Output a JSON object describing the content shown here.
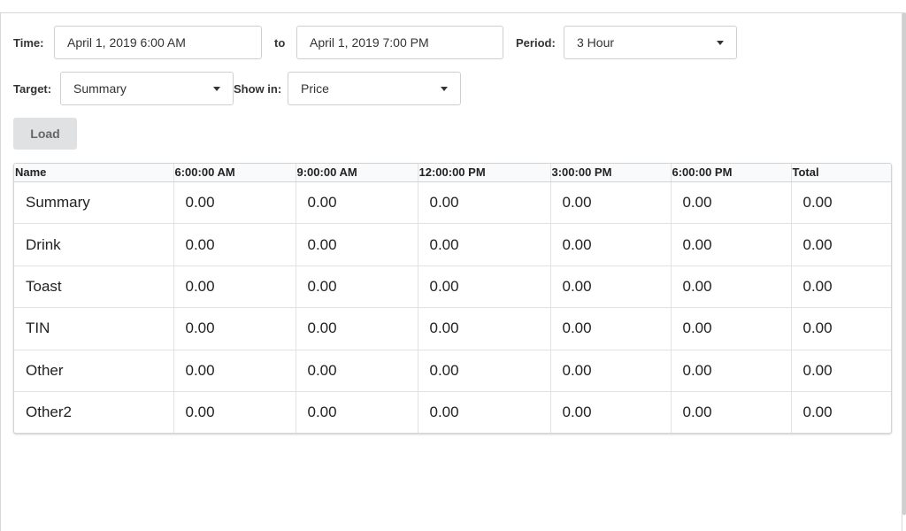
{
  "filters": {
    "time_label": "Time:",
    "time_from": "April 1, 2019 6:00 AM",
    "to_label": "to",
    "time_to": "April 1, 2019 7:00 PM",
    "period_label": "Period:",
    "period_value": "3 Hour",
    "target_label": "Target:",
    "target_value": "Summary",
    "show_in_label": "Show in:",
    "show_in_value": "Price",
    "load_label": "Load"
  },
  "table": {
    "headers": [
      "Name",
      "6:00:00 AM",
      "9:00:00 AM",
      "12:00:00 PM",
      "3:00:00 PM",
      "6:00:00 PM",
      "Total"
    ],
    "rows": [
      [
        "Summary",
        "0.00",
        "0.00",
        "0.00",
        "0.00",
        "0.00",
        "0.00"
      ],
      [
        "Drink",
        "0.00",
        "0.00",
        "0.00",
        "0.00",
        "0.00",
        "0.00"
      ],
      [
        "Toast",
        "0.00",
        "0.00",
        "0.00",
        "0.00",
        "0.00",
        "0.00"
      ],
      [
        "TIN",
        "0.00",
        "0.00",
        "0.00",
        "0.00",
        "0.00",
        "0.00"
      ],
      [
        "Other",
        "0.00",
        "0.00",
        "0.00",
        "0.00",
        "0.00",
        "0.00"
      ],
      [
        "Other2",
        "0.00",
        "0.00",
        "0.00",
        "0.00",
        "0.00",
        "0.00"
      ]
    ]
  }
}
